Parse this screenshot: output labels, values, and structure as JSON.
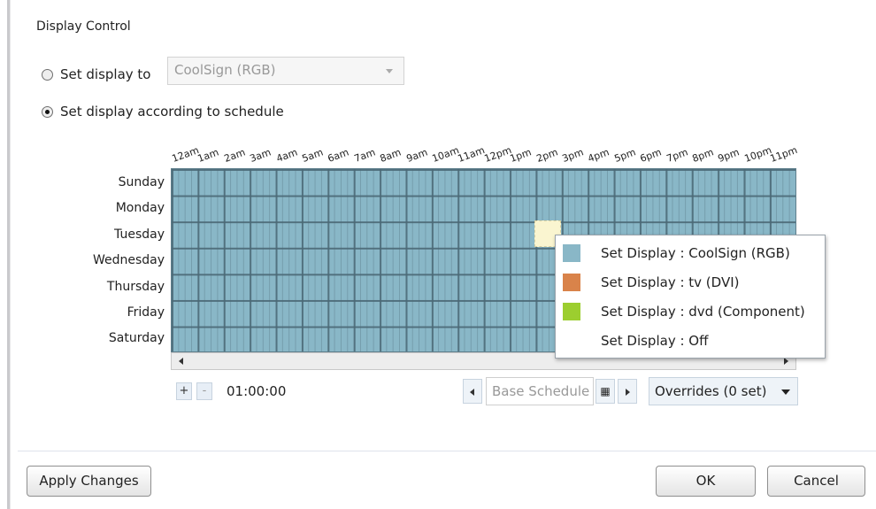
{
  "title": "Display Control",
  "options": {
    "set_display_label": "Set display to",
    "set_display_value": "CoolSign (RGB)",
    "schedule_label": "Set display according to schedule"
  },
  "hours": [
    "12am",
    "1am",
    "2am",
    "3am",
    "4am",
    "5am",
    "6am",
    "7am",
    "8am",
    "9am",
    "10am",
    "11am",
    "12pm",
    "1pm",
    "2pm",
    "3pm",
    "4pm",
    "5pm",
    "6pm",
    "7pm",
    "8pm",
    "9pm",
    "10pm",
    "11pm"
  ],
  "days": [
    "Sunday",
    "Monday",
    "Tuesday",
    "Wednesday",
    "Thursday",
    "Friday",
    "Saturday"
  ],
  "controls": {
    "zoom_in_label": "+",
    "zoom_out_label": "-",
    "time_increment": "01:00:00",
    "base_schedule_placeholder": "Base Schedule",
    "calendar_icon": "▦",
    "overrides_label": "Overrides (0 set)"
  },
  "legend": [
    {
      "label": "Set Display : CoolSign (RGB)",
      "color": "#89b7c7"
    },
    {
      "label": "Set Display : tv (DVI)",
      "color": "#d9834a"
    },
    {
      "label": "Set Display : dvd (Component)",
      "color": "#9cce2f"
    },
    {
      "label": "Set Display : Off",
      "color": "#ffffff"
    }
  ],
  "buttons": {
    "apply": "Apply Changes",
    "ok": "OK",
    "cancel": "Cancel"
  }
}
